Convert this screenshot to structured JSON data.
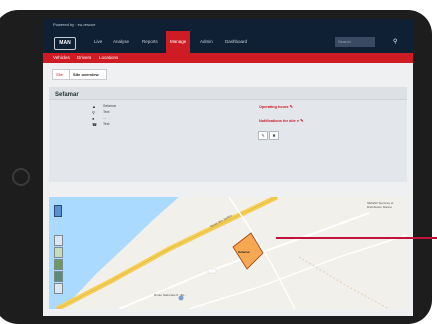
{
  "powered_by": "Powered by  ·  eu-rescue",
  "logo": "MAN",
  "nav": {
    "items": [
      "Live",
      "Analyse",
      "Reports",
      "Manage",
      "Admin",
      "Dashboard"
    ],
    "active": "Manage",
    "search_placeholder": "Search"
  },
  "subnav": {
    "items": [
      "Vehicles",
      "Drivers",
      "Locations"
    ]
  },
  "tabs": {
    "site": "Site",
    "overview": "Site overview"
  },
  "site": {
    "title": "Sefamar",
    "rows": [
      "Sefamar",
      "Text",
      "...",
      "Text"
    ],
    "operating_hours": "Operating hours",
    "notifications": "Notifications for site"
  },
  "map": {
    "road_label": "Route des Jardins",
    "place_label": "Sefamar",
    "poi_label": "Route Nationale 8 · Bo...",
    "side_label": "SEMAD Services et Distribution Marine"
  },
  "colors": {
    "nav_bg": "#0f1f34",
    "accent_red": "#cf1c24",
    "geofence": "#f5a040",
    "water": "#aadaff"
  }
}
